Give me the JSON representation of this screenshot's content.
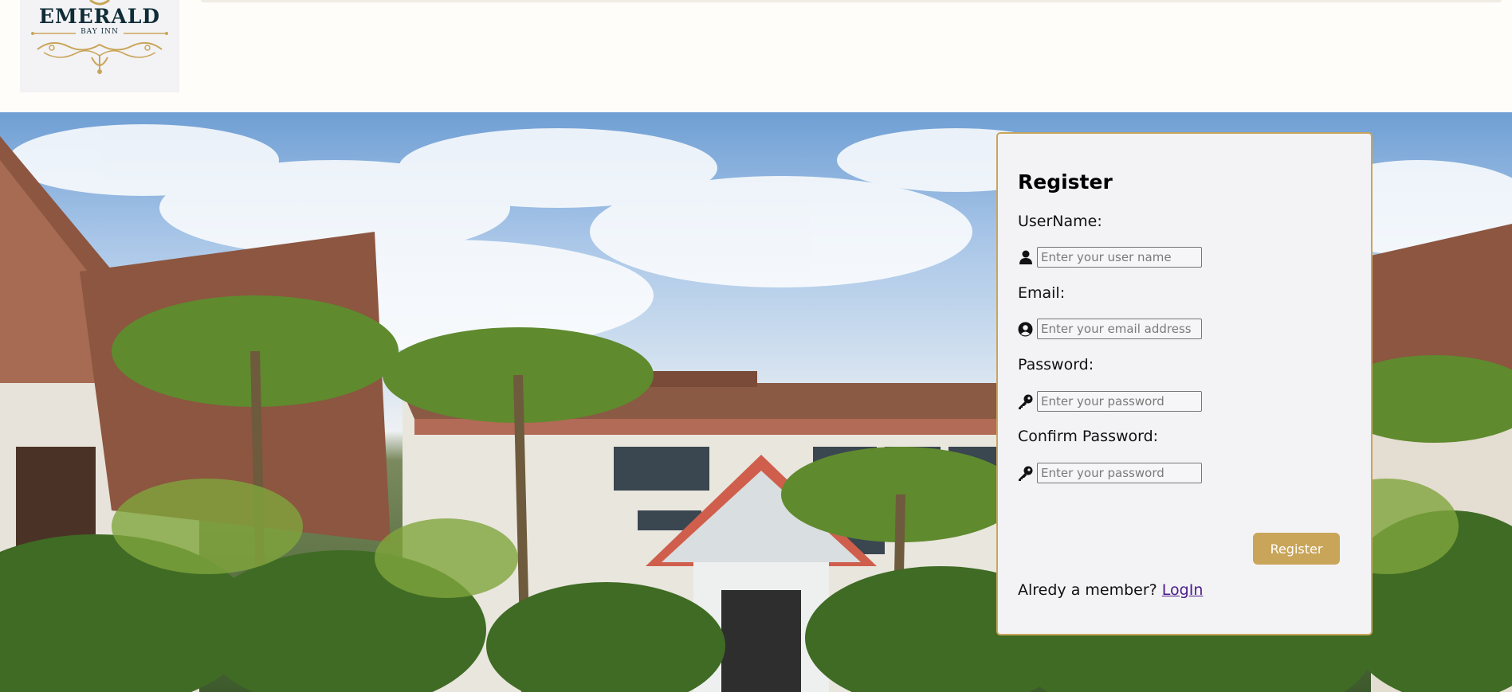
{
  "header": {
    "logo": {
      "name": "EMERALD",
      "sub": "BAY INN"
    }
  },
  "register": {
    "title": "Register",
    "fields": [
      {
        "label": "UserName:",
        "placeholder": "Enter your user name",
        "icon": "user-icon"
      },
      {
        "label": "Email:",
        "placeholder": "Enter your email address",
        "icon": "user-circle-icon"
      },
      {
        "label": "Password:",
        "placeholder": "Enter your password",
        "icon": "key-icon"
      },
      {
        "label": "Confirm Password:",
        "placeholder": "Enter your password",
        "icon": "key-icon"
      }
    ],
    "button_label": "Register",
    "member_text": "Alredy a member?",
    "login_label": "LogIn"
  },
  "colors": {
    "accent": "#c9a55a",
    "card_bg": "#f3f3f5",
    "logo_text": "#0f2c37",
    "link": "#4b1a8a"
  }
}
